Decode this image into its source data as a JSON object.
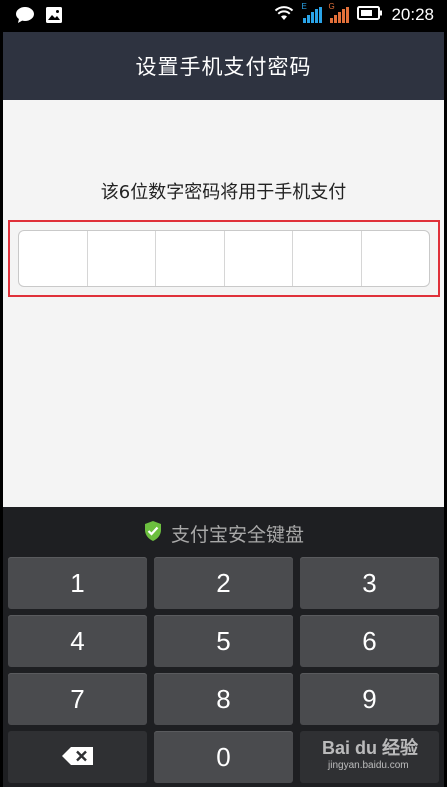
{
  "status_bar": {
    "time": "20:28",
    "icons": [
      "chat-bubble-icon",
      "gallery-icon",
      "wifi-icon",
      "signal-icon",
      "signal-icon",
      "battery-icon"
    ],
    "signal_1_tag": "E",
    "signal_2_tag": "G"
  },
  "title_bar": {
    "title": "设置手机支付密码"
  },
  "content": {
    "hint": "该6位数字密码将用于手机支付",
    "password_length": 6
  },
  "keyboard": {
    "title": "支付宝安全键盘",
    "shield_color": "#6cbf3f",
    "keys": [
      "1",
      "2",
      "3",
      "4",
      "5",
      "6",
      "7",
      "8",
      "9",
      "0"
    ],
    "delete_icon": "backspace-icon"
  },
  "watermark": {
    "logo": "Bai du 经验",
    "url": "jingyan.baidu.com"
  },
  "colors": {
    "title_bar_bg": "#2e3340",
    "highlight_border": "#e0313a",
    "keyboard_bg": "#1e1f22",
    "key_bg": "#4a4b4e"
  }
}
